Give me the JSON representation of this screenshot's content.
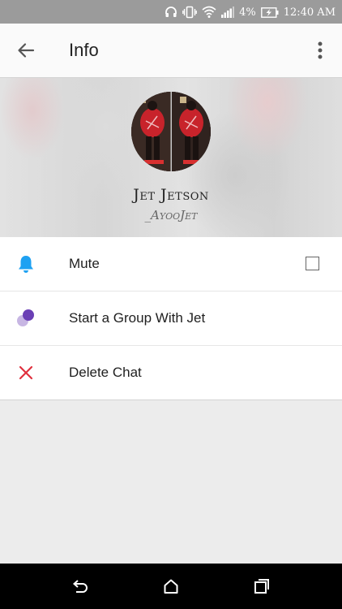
{
  "status_bar": {
    "battery_percent": "4%",
    "time": "12:40 AM",
    "icons": [
      "headphones-icon",
      "vibrate-icon",
      "wifi-icon",
      "signal-icon",
      "battery-charging-icon"
    ]
  },
  "app_bar": {
    "title": "Info",
    "back_icon": "arrow-back-icon",
    "menu_icon": "more-vert-icon"
  },
  "profile": {
    "name": "Jet Jetson",
    "handle": "_AyooJet"
  },
  "actions": [
    {
      "label": "Mute",
      "icon": "bell-icon",
      "icon_color": "#1ea1f2",
      "control": "checkbox",
      "checked": false
    },
    {
      "label": "Start a Group With Jet",
      "icon": "group-bubbles-icon",
      "icon_color": "#6a3fb5"
    },
    {
      "label": "Delete Chat",
      "icon": "close-x-icon",
      "icon_color": "#e0303e"
    }
  ],
  "nav_bar": {
    "icons": [
      "back-nav-icon",
      "home-nav-icon",
      "recents-nav-icon"
    ]
  }
}
